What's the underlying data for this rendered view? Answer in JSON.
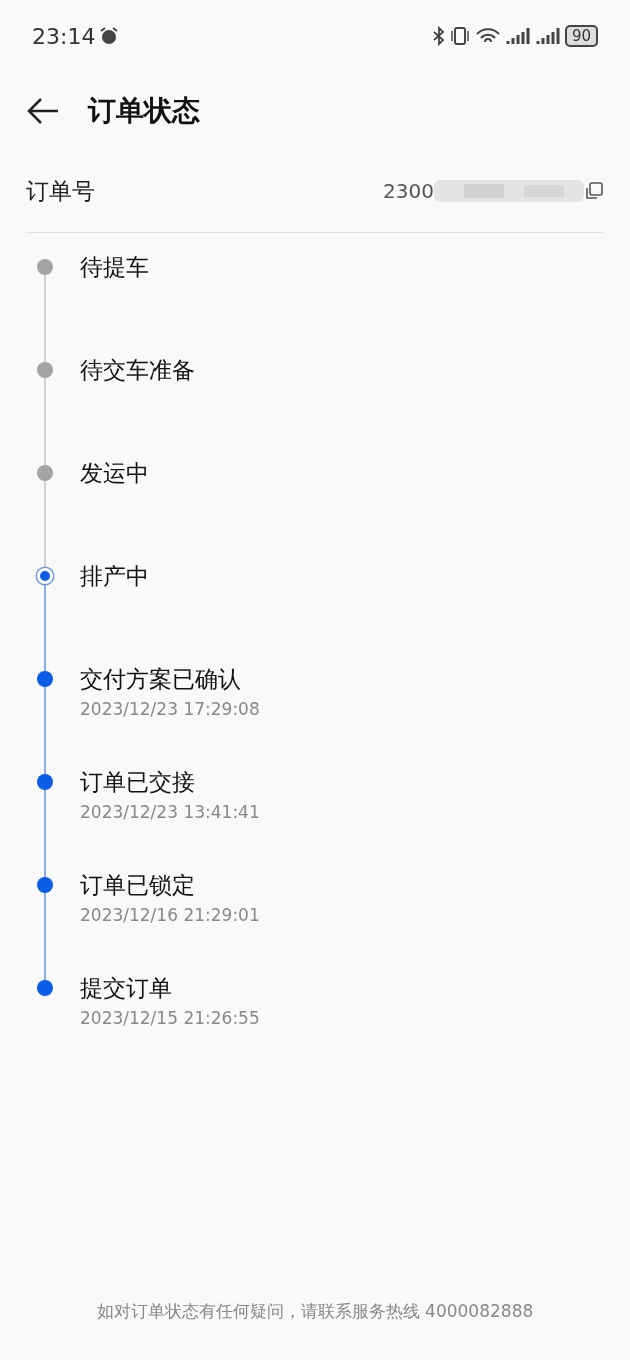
{
  "status_bar": {
    "time": "23:14",
    "battery": "90"
  },
  "header": {
    "title": "订单状态"
  },
  "order": {
    "label": "订单号",
    "number": "2300"
  },
  "steps": [
    {
      "kind": "pending",
      "title": "待提车"
    },
    {
      "kind": "pending",
      "title": "待交车准备"
    },
    {
      "kind": "pending",
      "title": "发运中"
    },
    {
      "kind": "current",
      "title": "排产中"
    },
    {
      "kind": "done",
      "title": "交付方案已确认",
      "time": "2023/12/23 17:29:08"
    },
    {
      "kind": "done",
      "title": "订单已交接",
      "time": "2023/12/23 13:41:41"
    },
    {
      "kind": "done",
      "title": "订单已锁定",
      "time": "2023/12/16 21:29:01"
    },
    {
      "kind": "done",
      "title": "提交订单",
      "time": "2023/12/15 21:26:55"
    }
  ],
  "footer": "如对订单状态有任何疑问，请联系服务热线 4000082888"
}
